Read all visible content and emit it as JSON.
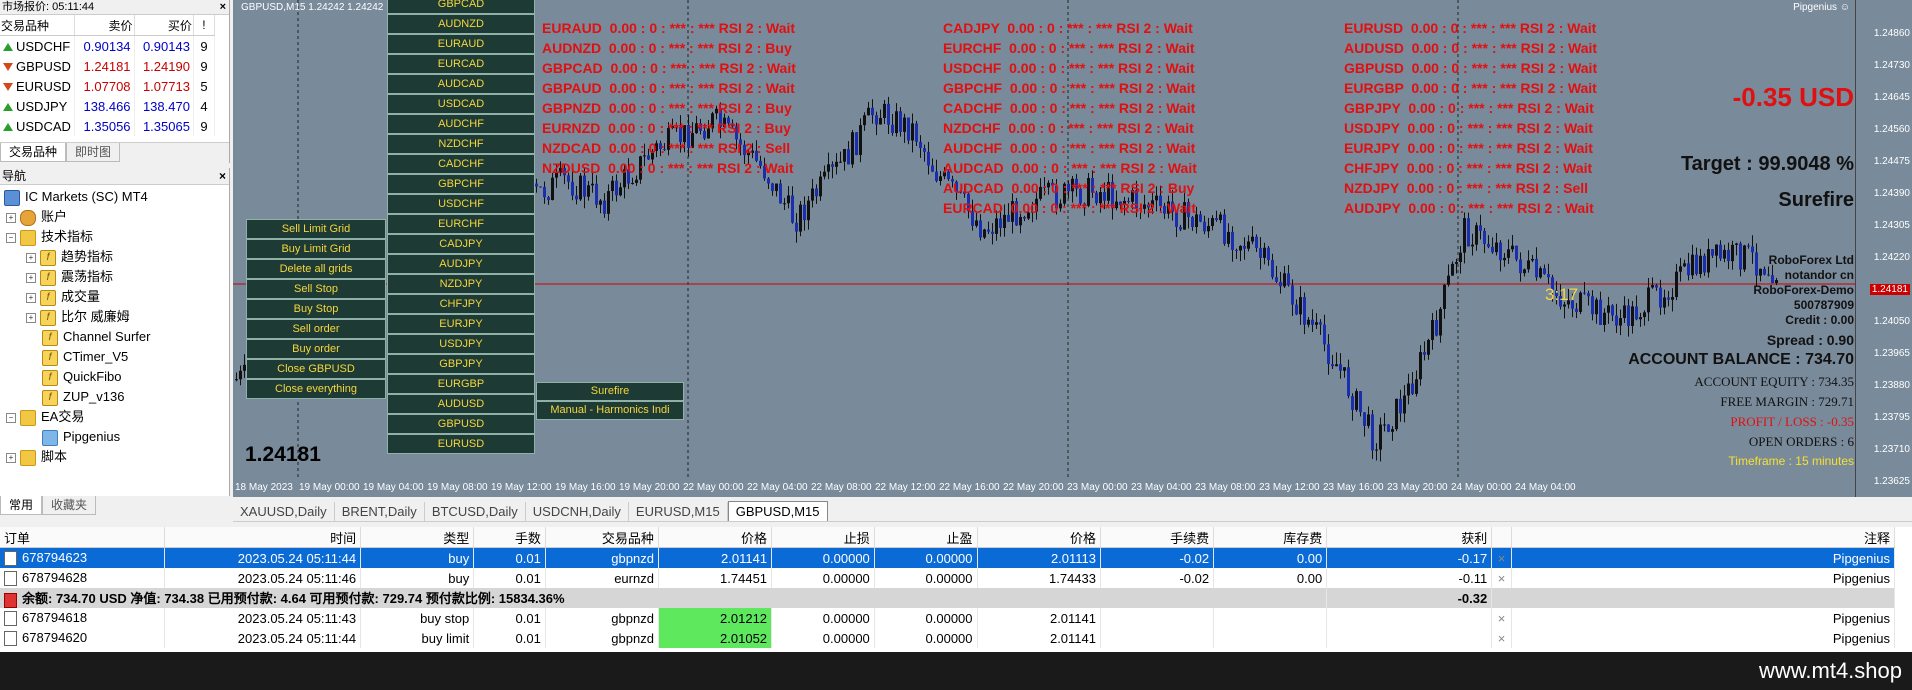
{
  "market_watch": {
    "title": "市场报价: 05:11:44",
    "headers": [
      "交易品种",
      "卖价",
      "买价",
      "!"
    ],
    "rows": [
      {
        "symbol": "USDCHF",
        "bid": "0.90134",
        "ask": "0.90143",
        "spread": "9",
        "dir": "up"
      },
      {
        "symbol": "GBPUSD",
        "bid": "1.24181",
        "ask": "1.24190",
        "spread": "9",
        "dir": "down"
      },
      {
        "symbol": "EURUSD",
        "bid": "1.07708",
        "ask": "1.07713",
        "spread": "5",
        "dir": "down"
      },
      {
        "symbol": "USDJPY",
        "bid": "138.466",
        "ask": "138.470",
        "spread": "4",
        "dir": "up"
      },
      {
        "symbol": "USDCAD",
        "bid": "1.35056",
        "ask": "1.35065",
        "spread": "9",
        "dir": "up"
      }
    ],
    "tabs": [
      "交易品种",
      "即时图"
    ]
  },
  "navigator": {
    "title": "导航",
    "items": [
      "IC Markets (SC) MT4",
      "账户",
      "技术指标",
      "趋势指标",
      "震荡指标",
      "成交量",
      "比尔 威廉姆",
      "Channel Surfer",
      "CTimer_V5",
      "QuickFibo",
      "ZUP_v136",
      "EA交易",
      "Pipgenius",
      "脚本"
    ],
    "tabs": [
      "常用",
      "收藏夹"
    ]
  },
  "chart": {
    "symbol_label": "GBPUSD,M15  1.24242 1.24242",
    "pipgenius_label": "Pipgenius",
    "price_box": "1.24181",
    "timer": "3:17",
    "pair_buttons": [
      "GBPCAD",
      "AUDNZD",
      "EURAUD",
      "EURCAD",
      "AUDCAD",
      "USDCAD",
      "AUDCHF",
      "NZDCHF",
      "CADCHF",
      "GBPCHF",
      "USDCHF",
      "EURCHF",
      "CADJPY",
      "AUDJPY",
      "NZDJPY",
      "CHFJPY",
      "EURJPY",
      "USDJPY",
      "GBPJPY",
      "EURGBP",
      "AUDUSD",
      "GBPUSD",
      "EURUSD"
    ],
    "action_buttons": [
      "Sell Limit Grid",
      "Buy Limit Grid",
      "Delete all grids",
      "Sell Stop",
      "Buy Stop",
      "Sell order",
      "Buy order",
      "Close GBPUSD",
      "Close everything"
    ],
    "extra_buttons": [
      "Surefire",
      "Manual - Harmonics Indi"
    ],
    "rsi_col1": [
      "EURAUD  0.00 : 0 : *** : *** RSI 2 : Wait",
      "AUDNZD  0.00 : 0 : *** : *** RSI 2 : Buy",
      "GBPCAD  0.00 : 0 : *** : *** RSI 2 : Wait",
      "GBPAUD  0.00 : 0 : *** : *** RSI 2 : Wait",
      "GBPNZD  0.00 : 0 : *** : *** RSI 2 : Buy",
      "EURNZD  0.00 : 0 : *** : *** RSI 2 : Buy",
      "NZDCAD  0.00 : 0 : *** : *** RSI 2 : Sell",
      "NZDUSD  0.00 : 0 : *** : *** RSI 2 : Wait"
    ],
    "rsi_col2": [
      "CADJPY  0.00 : 0 : *** : *** RSI 2 : Wait",
      "EURCHF  0.00 : 0 : *** : *** RSI 2 : Wait",
      "USDCHF  0.00 : 0 : *** : *** RSI 2 : Wait",
      "GBPCHF  0.00 : 0 : *** : *** RSI 2 : Wait",
      "CADCHF  0.00 : 0 : *** : *** RSI 2 : Wait",
      "NZDCHF  0.00 : 0 : *** : *** RSI 2 : Wait",
      "AUDCHF  0.00 : 0 : *** : *** RSI 2 : Wait",
      "AUDCAD  0.00 : 0 : *** : *** RSI 2 : Wait",
      "AUDCAD  0.00 : 0 : *** : *** RSI 2 : Buy",
      "EURCAD  0.00 : 0 : *** : *** RSI 2 : Wait"
    ],
    "rsi_col3": [
      "EURUSD  0.00 : 0 : *** : *** RSI 2 : Wait",
      "AUDUSD  0.00 : 0 : *** : *** RSI 2 : Wait",
      "GBPUSD  0.00 : 0 : *** : *** RSI 2 : Wait",
      "EURGBP  0.00 : 0 : *** : *** RSI 2 : Wait",
      "GBPJPY  0.00 : 0 : *** : *** RSI 2 : Wait",
      "USDJPY  0.00 : 0 : *** : *** RSI 2 : Wait",
      "EURJPY  0.00 : 0 : *** : *** RSI 2 : Wait",
      "CHFJPY  0.00 : 0 : *** : *** RSI 2 : Wait",
      "NZDJPY  0.00 : 0 : *** : *** RSI 2 : Sell",
      "AUDJPY  0.00 : 0 : *** : *** RSI 2 : Wait"
    ],
    "info": {
      "pnl": "-0.35 USD",
      "target": "Target : 99.9048 %",
      "surefire": "Surefire",
      "broker": "RoboForex Ltd",
      "user": "notandor cn",
      "server": "RoboForex-Demo",
      "account": "500787909",
      "credit": "Credit : 0.00",
      "spread": "Spread : 0.90",
      "balance": "ACCOUNT BALANCE : 734.70",
      "equity": "ACCOUNT EQUITY : 734.35",
      "free_margin": "FREE MARGIN : 729.71",
      "profit_loss": "PROFIT / LOSS : -0.35",
      "open_orders": "OPEN ORDERS : 6",
      "timeframe": "Timeframe : 15 minutes"
    },
    "y_ticks": [
      "1.24860",
      "1.24730",
      "1.24645",
      "1.24560",
      "1.24475",
      "1.24390",
      "1.24305",
      "1.24220",
      "1.24181",
      "1.24050",
      "1.23965",
      "1.23880",
      "1.23795",
      "1.23710",
      "1.23625"
    ],
    "x_ticks": [
      "18 May 2023",
      "19 May 00:00",
      "19 May 04:00",
      "19 May 08:00",
      "19 May 12:00",
      "19 May 16:00",
      "19 May 20:00",
      "22 May 00:00",
      "22 May 04:00",
      "22 May 08:00",
      "22 May 12:00",
      "22 May 16:00",
      "22 May 20:00",
      "23 May 00:00",
      "23 May 04:00",
      "23 May 08:00",
      "23 May 12:00",
      "23 May 16:00",
      "23 May 20:00",
      "24 May 00:00",
      "24 May 04:00"
    ]
  },
  "chart_tabs": [
    "XAUUSD,Daily",
    "BRENT,Daily",
    "BTCUSD,Daily",
    "USDCNH,Daily",
    "EURUSD,M15",
    "GBPUSD,M15"
  ],
  "orders": {
    "headers": [
      "订单",
      "时间",
      "类型",
      "手数",
      "交易品种",
      "价格",
      "止损",
      "止盈",
      "价格",
      "手续费",
      "库存费",
      "获利",
      "",
      "注释"
    ],
    "rows": [
      [
        "678794623",
        "2023.05.24 05:11:44",
        "buy",
        "0.01",
        "gbpnzd",
        "2.01141",
        "0.00000",
        "0.00000",
        "2.01113",
        "-0.02",
        "0.00",
        "-0.17",
        "×",
        "Pipgenius"
      ],
      [
        "678794628",
        "2023.05.24 05:11:46",
        "buy",
        "0.01",
        "eurnzd",
        "1.74451",
        "0.00000",
        "0.00000",
        "1.74433",
        "-0.02",
        "0.00",
        "-0.11",
        "×",
        "Pipgenius"
      ]
    ],
    "balance_line": "余额: 734.70 USD  净值: 734.38  已用预付款: 4.64  可用预付款: 729.74  预付款比例: 15834.36%",
    "balance_total": "-0.32",
    "pending": [
      [
        "678794618",
        "2023.05.24 05:11:43",
        "buy stop",
        "0.01",
        "gbpnzd",
        "2.01212",
        "0.00000",
        "0.00000",
        "2.01141",
        "",
        "",
        "",
        "×",
        "Pipgenius"
      ],
      [
        "678794620",
        "2023.05.24 05:11:44",
        "buy limit",
        "0.01",
        "gbpnzd",
        "2.01052",
        "0.00000",
        "0.00000",
        "2.01141",
        "",
        "",
        "",
        "×",
        "Pipgenius"
      ]
    ]
  },
  "footer": "www.mt4.shop"
}
